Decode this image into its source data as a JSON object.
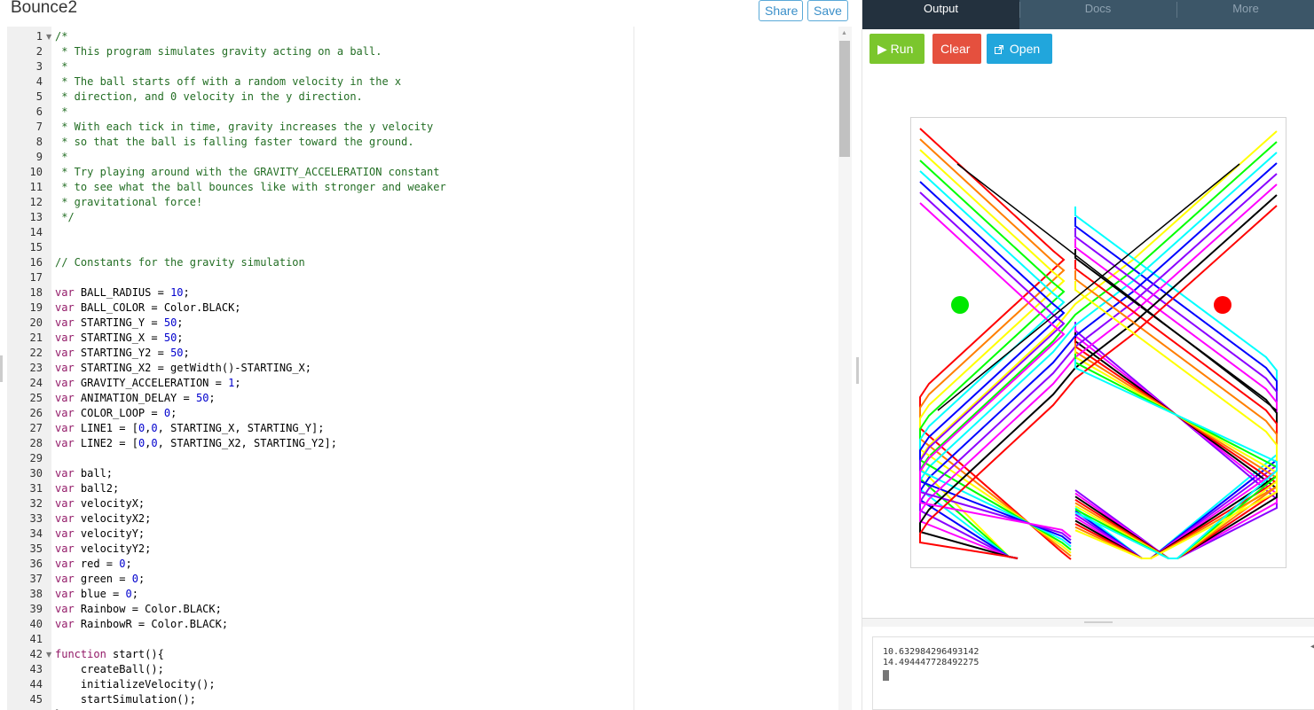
{
  "header": {
    "title": "Bounce2",
    "share_label": "Share",
    "save_label": "Save"
  },
  "editor": {
    "lines": [
      [
        [
          "c",
          "/*"
        ]
      ],
      [
        [
          "c",
          " * This program simulates gravity acting on a ball."
        ]
      ],
      [
        [
          "c",
          " *"
        ]
      ],
      [
        [
          "c",
          " * The ball starts off with a random velocity in the x"
        ]
      ],
      [
        [
          "c",
          " * direction, and 0 velocity in the y direction."
        ]
      ],
      [
        [
          "c",
          " *"
        ]
      ],
      [
        [
          "c",
          " * With each tick in time, gravity increases the y velocity"
        ]
      ],
      [
        [
          "c",
          " * so that the ball is falling faster toward the ground."
        ]
      ],
      [
        [
          "c",
          " *"
        ]
      ],
      [
        [
          "c",
          " * Try playing around with the GRAVITY_ACCELERATION constant"
        ]
      ],
      [
        [
          "c",
          " * to see what the ball bounces like with stronger and weaker"
        ]
      ],
      [
        [
          "c",
          " * gravitational force!"
        ]
      ],
      [
        [
          "c",
          " */"
        ]
      ],
      [],
      [],
      [
        [
          "c",
          "// Constants for the gravity simulation"
        ]
      ],
      [],
      [
        [
          "k",
          "var"
        ],
        [
          "t",
          " BALL_RADIUS = "
        ],
        [
          "n",
          "10"
        ],
        [
          "t",
          ";"
        ]
      ],
      [
        [
          "k",
          "var"
        ],
        [
          "t",
          " BALL_COLOR = Color.BLACK;"
        ]
      ],
      [
        [
          "k",
          "var"
        ],
        [
          "t",
          " STARTING_Y = "
        ],
        [
          "n",
          "50"
        ],
        [
          "t",
          ";"
        ]
      ],
      [
        [
          "k",
          "var"
        ],
        [
          "t",
          " STARTING_X = "
        ],
        [
          "n",
          "50"
        ],
        [
          "t",
          ";"
        ]
      ],
      [
        [
          "k",
          "var"
        ],
        [
          "t",
          " STARTING_Y2 = "
        ],
        [
          "n",
          "50"
        ],
        [
          "t",
          ";"
        ]
      ],
      [
        [
          "k",
          "var"
        ],
        [
          "t",
          " STARTING_X2 = getWidth()-STARTING_X;"
        ]
      ],
      [
        [
          "k",
          "var"
        ],
        [
          "t",
          " GRAVITY_ACCELERATION = "
        ],
        [
          "n",
          "1"
        ],
        [
          "t",
          ";"
        ]
      ],
      [
        [
          "k",
          "var"
        ],
        [
          "t",
          " ANIMATION_DELAY = "
        ],
        [
          "n",
          "50"
        ],
        [
          "t",
          ";"
        ]
      ],
      [
        [
          "k",
          "var"
        ],
        [
          "t",
          " COLOR_LOOP = "
        ],
        [
          "n",
          "0"
        ],
        [
          "t",
          ";"
        ]
      ],
      [
        [
          "k",
          "var"
        ],
        [
          "t",
          " LINE1 = ["
        ],
        [
          "n",
          "0"
        ],
        [
          "t",
          ","
        ],
        [
          "n",
          "0"
        ],
        [
          "t",
          ", STARTING_X, STARTING_Y];"
        ]
      ],
      [
        [
          "k",
          "var"
        ],
        [
          "t",
          " LINE2 = ["
        ],
        [
          "n",
          "0"
        ],
        [
          "t",
          ","
        ],
        [
          "n",
          "0"
        ],
        [
          "t",
          ", STARTING_X2, STARTING_Y2];"
        ]
      ],
      [],
      [
        [
          "k",
          "var"
        ],
        [
          "t",
          " ball;"
        ]
      ],
      [
        [
          "k",
          "var"
        ],
        [
          "t",
          " ball2;"
        ]
      ],
      [
        [
          "k",
          "var"
        ],
        [
          "t",
          " velocityX;"
        ]
      ],
      [
        [
          "k",
          "var"
        ],
        [
          "t",
          " velocityX2;"
        ]
      ],
      [
        [
          "k",
          "var"
        ],
        [
          "t",
          " velocityY;"
        ]
      ],
      [
        [
          "k",
          "var"
        ],
        [
          "t",
          " velocityY2;"
        ]
      ],
      [
        [
          "k",
          "var"
        ],
        [
          "t",
          " red = "
        ],
        [
          "n",
          "0"
        ],
        [
          "t",
          ";"
        ]
      ],
      [
        [
          "k",
          "var"
        ],
        [
          "t",
          " green = "
        ],
        [
          "n",
          "0"
        ],
        [
          "t",
          ";"
        ]
      ],
      [
        [
          "k",
          "var"
        ],
        [
          "t",
          " blue = "
        ],
        [
          "n",
          "0"
        ],
        [
          "t",
          ";"
        ]
      ],
      [
        [
          "k",
          "var"
        ],
        [
          "t",
          " Rainbow = Color.BLACK;"
        ]
      ],
      [
        [
          "k",
          "var"
        ],
        [
          "t",
          " RainbowR = Color.BLACK;"
        ]
      ],
      [],
      [
        [
          "k",
          "function"
        ],
        [
          "t",
          " start(){"
        ]
      ],
      [
        [
          "t",
          "    createBall();"
        ]
      ],
      [
        [
          "t",
          "    initializeVelocity();"
        ]
      ],
      [
        [
          "t",
          "    startSimulation();"
        ]
      ],
      [
        [
          "t",
          "}"
        ]
      ]
    ],
    "fold_lines": [
      1,
      42
    ]
  },
  "output": {
    "tabs": [
      "Output",
      "Docs",
      "More"
    ],
    "active_tab": "Output",
    "run_label": "Run",
    "clear_label": "Clear",
    "open_label": "Open",
    "run_icon": "play-icon",
    "open_icon": "external-link-icon",
    "canvas": {
      "balls": [
        {
          "color": "#00e800"
        },
        {
          "color": "#ff0000"
        }
      ],
      "trail_colors": [
        "#000000",
        "#ff0000",
        "#ff7f00",
        "#ffff00",
        "#00ff00",
        "#00ffff",
        "#0000ff",
        "#8b00ff",
        "#ff00ff"
      ]
    },
    "console": {
      "lines": [
        "10.632984296493142",
        "14.494447728492275"
      ]
    }
  },
  "colors": {
    "run": "#7bc62d",
    "clear": "#e5503e",
    "open": "#21a6dc",
    "tabbar": "#3c5668",
    "tab_active": "#23313e"
  }
}
